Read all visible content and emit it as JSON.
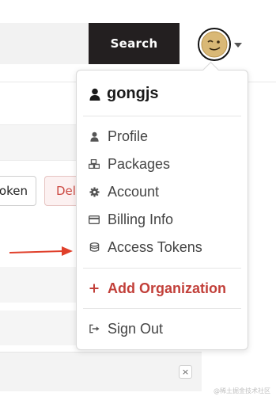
{
  "header": {
    "search_label": "Search",
    "avatar_alt": "user-avatar"
  },
  "background": {
    "token_button_label": "oken",
    "delete_button_label": "Dele",
    "close_label": "×",
    "watermark": "@稀土掘金技术社区"
  },
  "dropdown": {
    "username": "gongjs",
    "items": [
      {
        "label": "Profile",
        "icon": "user-icon"
      },
      {
        "label": "Packages",
        "icon": "packages-icon"
      },
      {
        "label": "Account",
        "icon": "gear-icon"
      },
      {
        "label": "Billing Info",
        "icon": "credit-card-icon"
      },
      {
        "label": "Access Tokens",
        "icon": "tokens-icon"
      }
    ],
    "add_org": {
      "label": "Add Organization",
      "icon": "plus-icon"
    },
    "sign_out": {
      "label": "Sign Out",
      "icon": "sign-out-icon"
    }
  },
  "colors": {
    "accent_red": "#c2403a",
    "search_bg": "#231f20",
    "arrow": "#e0402b"
  }
}
